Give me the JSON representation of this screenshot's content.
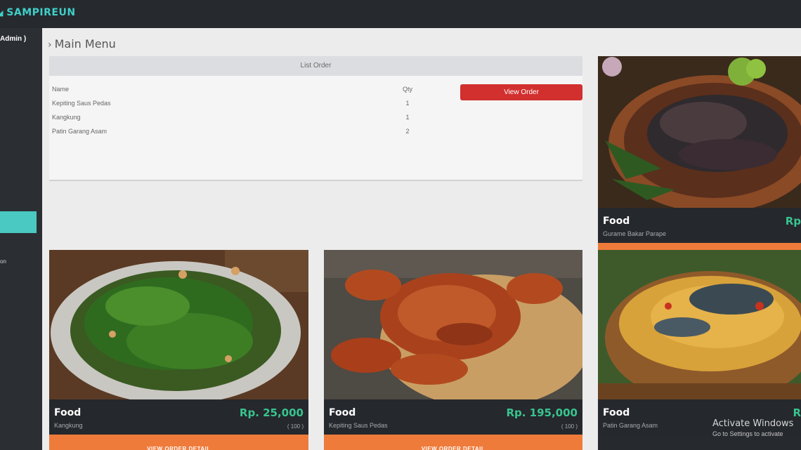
{
  "app": {
    "brand": "SAMPIREUN"
  },
  "sidebar": {
    "user": "Admin )",
    "item_label": "on"
  },
  "main": {
    "title": "Main Menu"
  },
  "order": {
    "header": "List Order",
    "col_name": "Name",
    "col_qty": "Qty",
    "items": [
      {
        "name": "Kepiting Saus Pedas",
        "qty": "1"
      },
      {
        "name": "Kangkung",
        "qty": "1"
      },
      {
        "name": "Patin Garang Asam",
        "qty": "2"
      }
    ],
    "view_button": "View Order"
  },
  "menu_cards": [
    {
      "category": "Food",
      "name": "Kangkung",
      "price": "Rp. 25,000",
      "stock": "( 100 )",
      "button": "VIEW ORDER DETAIL"
    },
    {
      "category": "Food",
      "name": "Kepiting Saus Pedas",
      "price": "Rp. 195,000",
      "stock": "( 100 )",
      "button": "VIEW ORDER DETAIL"
    },
    {
      "category": "Food",
      "name": "Gurame Bakar Parape",
      "price": "Rp"
    },
    {
      "category": "Food",
      "name": "Patin Garang Asam",
      "price": "R"
    }
  ],
  "os_watermark": {
    "title": "Activate Windows",
    "subtitle": "Go to Settings to activate"
  },
  "colors": {
    "accent": "#3fd0c8",
    "price": "#38c48f",
    "danger": "#d22f2f",
    "orange": "#ef7b3b"
  }
}
